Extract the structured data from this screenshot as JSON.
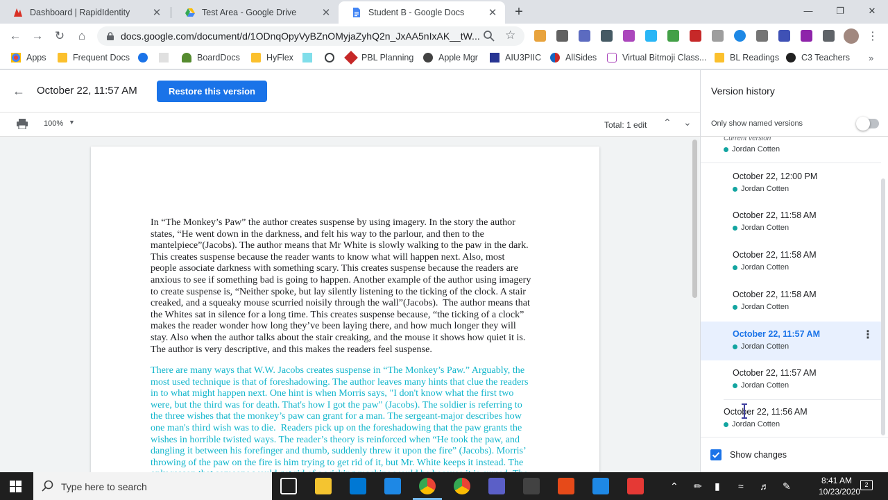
{
  "browser": {
    "tabs": [
      {
        "title": "Dashboard | RapidIdentity",
        "close": "✕"
      },
      {
        "title": "Test Area - Google Drive",
        "close": "✕"
      },
      {
        "title": "Student B - Google Docs",
        "close": "✕"
      }
    ],
    "new_tab": "+",
    "url": "docs.google.com/document/d/1ODnqOpyVyBZnOMyjaZyhQ2n_JxAA5nIxAK__tW...",
    "bookmarks": [
      {
        "label": "Apps"
      },
      {
        "label": "Frequent Docs"
      },
      {
        "label": ""
      },
      {
        "label": ""
      },
      {
        "label": "BoardDocs"
      },
      {
        "label": "HyFlex"
      },
      {
        "label": ""
      },
      {
        "label": ""
      },
      {
        "label": "PBL Planning"
      },
      {
        "label": "Apple Mgr"
      },
      {
        "label": "AIU3PIIC"
      },
      {
        "label": "AllSides"
      },
      {
        "label": "Virtual Bitmoji Class..."
      },
      {
        "label": "BL Readings"
      },
      {
        "label": "C3 Teachers"
      }
    ],
    "bookmarks_more": "»"
  },
  "header": {
    "back": "←",
    "version_title": "October 22, 11:57 AM",
    "restore_label": "Restore this version"
  },
  "subbar": {
    "zoom": "100%",
    "total_edits": "Total: 1 edit"
  },
  "document": {
    "paragraph1": [
      "In “The Monkey’s Paw” the author creates suspense by using imagery. In the story the author",
      "states, “He went down in the darkness, and felt his way to the parlour, and then to the",
      "mantelpiece”(Jacobs). The author means that Mr White is slowly walking to the paw in the dark.",
      "This creates suspense because the reader wants to know what will happen next. Also, most",
      "people associate darkness with something scary. This creates suspense because the readers are",
      "anxious to see if something bad is going to happen. Another example of the author using imagery",
      "to create suspense is, “Neither spoke, but lay silently listening to the ticking of the clock. A stair",
      "creaked, and a squeaky mouse scurried noisily through the wall”(Jacobs).  The author means that",
      "the Whites sat in silence for a long time. This creates suspense because, “the ticking of a clock”",
      "makes the reader wonder how long they’ve been laying there, and how much longer they will",
      "stay. Also when the author talks about the stair creaking, and the mouse it shows how quiet it is.",
      "The author is very descriptive, and this makes the readers feel suspense."
    ],
    "paragraph2": [
      "There are many ways that W.W. Jacobs creates suspense in “The Monkey’s Paw.” Arguably, the",
      "most used technique is that of foreshadowing. The author leaves many hints that clue the readers",
      "in to what might happen next. One hint is when Morris says, \"I don't know what the first two",
      "were, but the third was for death. That's how I got the paw\" (Jacobs). The soldier is referring to",
      "the three wishes that the monkey’s paw can grant for a man. The sergeant-major describes how",
      "one man's third wish was to die.  Readers pick up on the foreshadowing that the paw grants the",
      "wishes in horrible twisted ways. The reader’s theory is reinforced when “He took the paw, and",
      "dangling it between his forefinger and thumb, suddenly threw it upon the fire” (Jacobs). Morris’",
      "throwing of the paw on the fire is him trying to get rid of it, but Mr. White keeps it instead. The",
      "only reason that someone would get rid of a wishing machine would be because it is cursed. The"
    ]
  },
  "version_history": {
    "title": "Version history",
    "named_only_label": "Only show named versions",
    "named_only_on": false,
    "current_version_label": "Current version",
    "versions": [
      {
        "date": "",
        "author": "Jordan Cotten",
        "current": true
      },
      {
        "date": "October 22, 12:00 PM",
        "author": "Jordan Cotten"
      },
      {
        "date": "October 22, 11:58 AM",
        "author": "Jordan Cotten"
      },
      {
        "date": "October 22, 11:58 AM",
        "author": "Jordan Cotten"
      },
      {
        "date": "October 22, 11:58 AM",
        "author": "Jordan Cotten"
      },
      {
        "date": "October 22, 11:57 AM",
        "author": "Jordan Cotten",
        "selected": true
      },
      {
        "date": "October 22, 11:57 AM",
        "author": "Jordan Cotten"
      },
      {
        "date": "October 22, 11:56 AM",
        "author": "Jordan Cotten"
      }
    ],
    "show_changes_label": "Show changes",
    "show_changes_checked": true,
    "author_color": "#12a4a0",
    "highlight_color": "#12b5cb"
  },
  "taskbar": {
    "search_placeholder": "Type here to search",
    "time": "8:41 AM",
    "date": "10/23/2020",
    "notifications": "2"
  },
  "colors": {
    "accent": "#1a73e8",
    "selected_bg": "#e8f0fe"
  }
}
